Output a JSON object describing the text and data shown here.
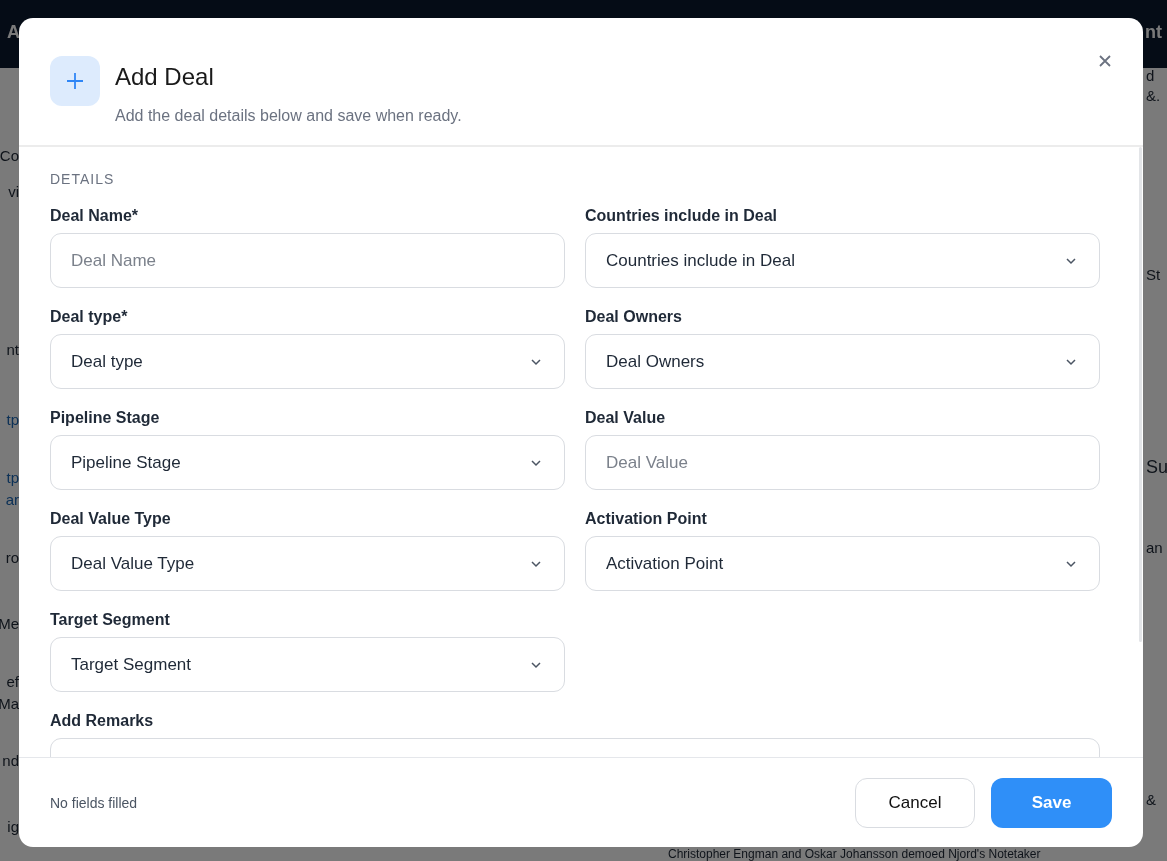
{
  "background": {
    "header_left": "A",
    "header_right": "nt",
    "left_fragments": [
      {
        "text": "Co",
        "link": false
      },
      {
        "text": "vi",
        "link": false
      },
      {
        "text": "nt",
        "link": false
      },
      {
        "text": "tp",
        "link": true
      },
      {
        "text": "tp",
        "link": true
      },
      {
        "text": "ar",
        "link": true
      },
      {
        "text": "ro",
        "link": false
      },
      {
        "text": "Me",
        "link": false
      },
      {
        "text": "ef",
        "link": false
      },
      {
        "text": "Ma",
        "link": false
      },
      {
        "text": "nd",
        "link": false
      },
      {
        "text": "ig",
        "link": false
      }
    ],
    "right_fragments": [
      "d",
      "&.",
      "St",
      "Su",
      "an",
      "&"
    ],
    "bottom_text": "Christopher Engman and Oskar Johansson demoed Njord's Notetaker"
  },
  "dialog": {
    "title": "Add Deal",
    "subtitle": "Add the deal details below and save when ready.",
    "section": "DETAILS",
    "fields": [
      {
        "kind": "text",
        "label": "Deal Name*",
        "placeholder": "Deal Name"
      },
      {
        "kind": "select",
        "label": "Countries include in Deal",
        "value": "Countries include in Deal"
      },
      {
        "kind": "select",
        "label": "Deal type*",
        "value": "Deal type"
      },
      {
        "kind": "select",
        "label": "Deal Owners",
        "value": "Deal Owners"
      },
      {
        "kind": "select",
        "label": "Pipeline Stage",
        "value": "Pipeline Stage"
      },
      {
        "kind": "text",
        "label": "Deal Value",
        "placeholder": "Deal Value"
      },
      {
        "kind": "select",
        "label": "Deal Value Type",
        "value": "Deal Value Type"
      },
      {
        "kind": "select",
        "label": "Activation Point",
        "value": "Activation Point"
      },
      {
        "kind": "select",
        "label": "Target Segment",
        "value": "Target Segment"
      },
      {
        "kind": "textarea",
        "label": "Add Remarks"
      }
    ],
    "status": "No fields filled",
    "buttons": [
      {
        "kind": "secondary",
        "label": "Cancel"
      },
      {
        "kind": "primary",
        "label": "Save"
      }
    ]
  }
}
